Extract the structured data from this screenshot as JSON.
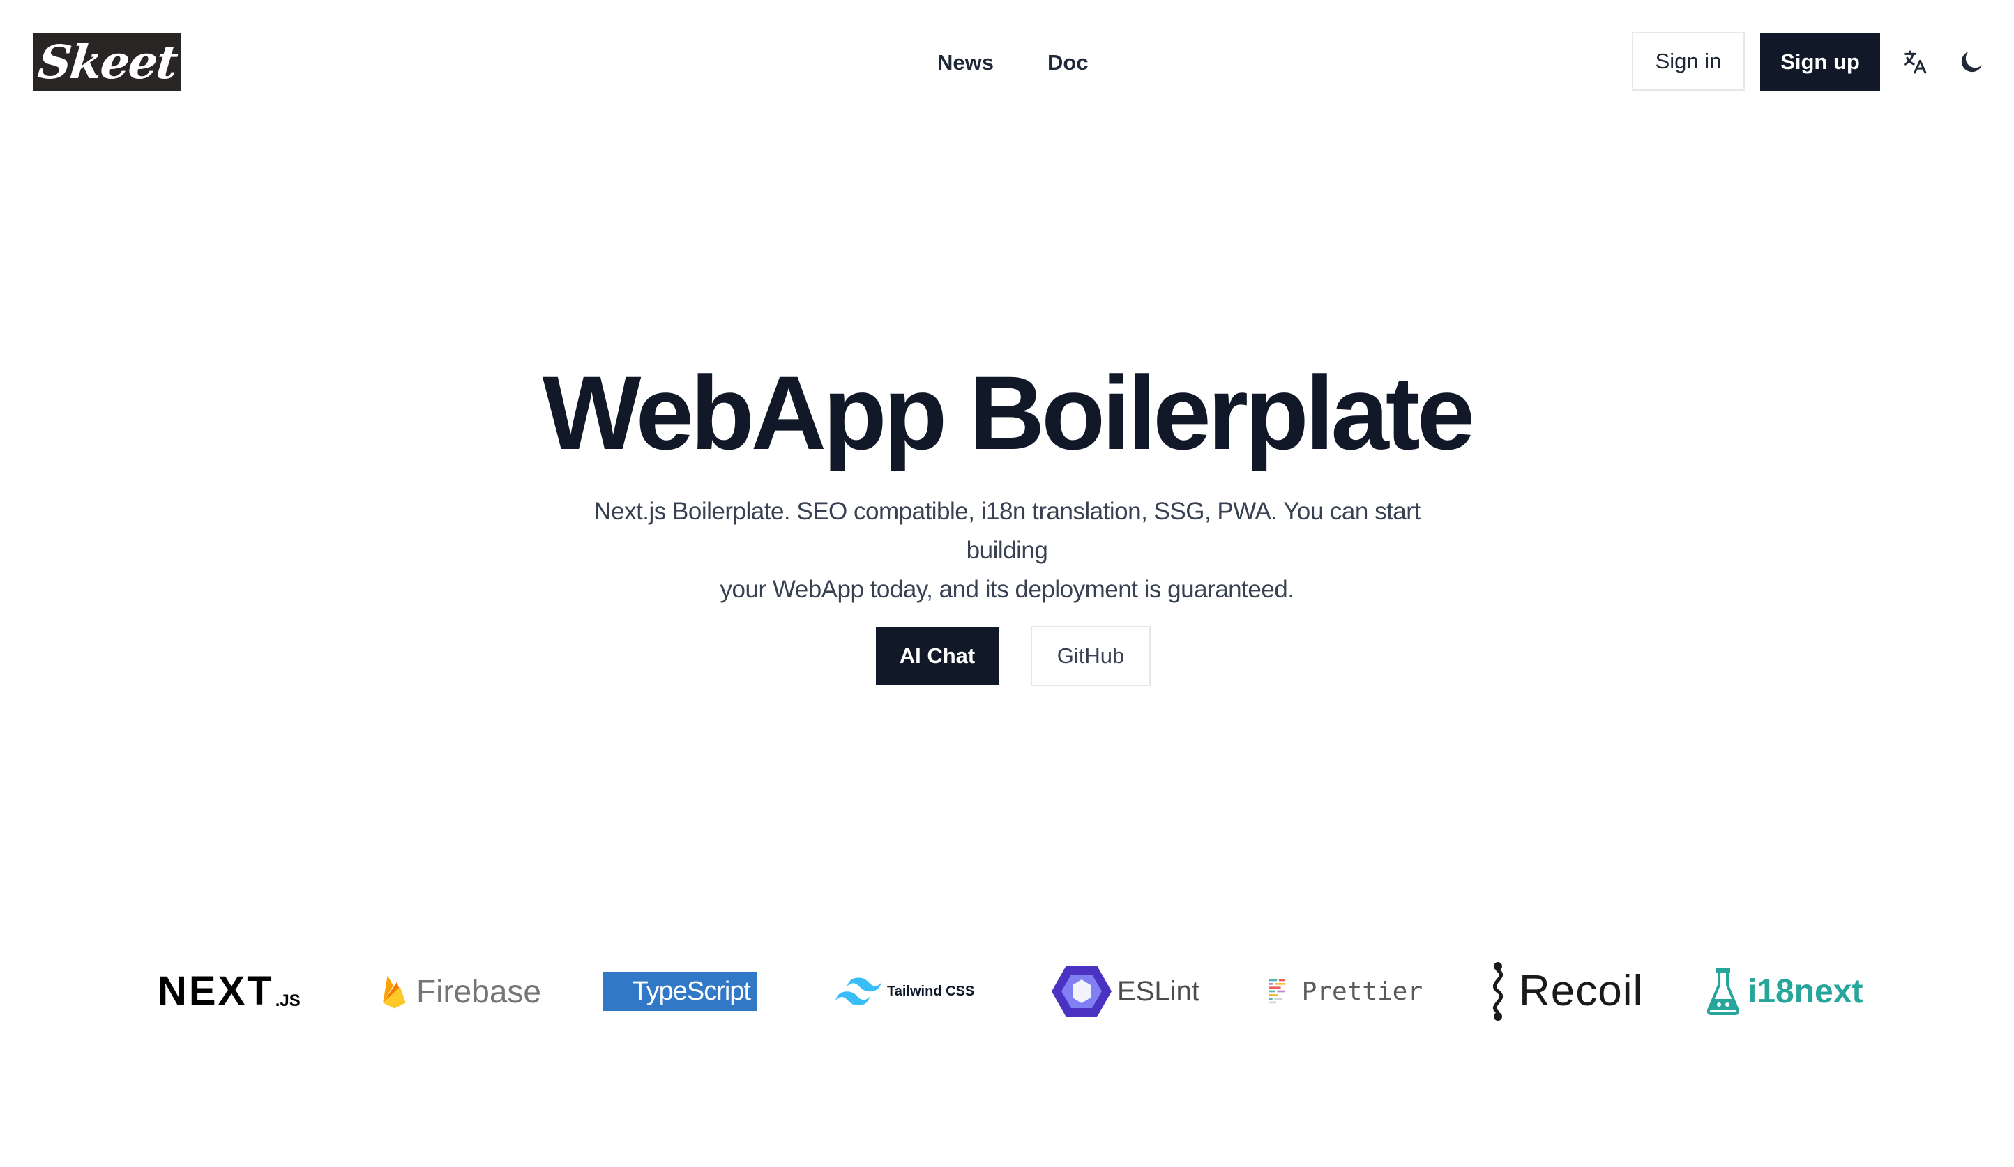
{
  "header": {
    "logo_text": "Skeet",
    "nav": [
      {
        "label": "News"
      },
      {
        "label": "Doc"
      }
    ],
    "sign_in_label": "Sign in",
    "sign_up_label": "Sign up",
    "icons": [
      "translate-icon",
      "moon-icon"
    ]
  },
  "hero": {
    "title": "WebApp Boilerplate",
    "description_line1": "Next.js Boilerplate. SEO compatible, i18n translation, SSG, PWA. You can start building",
    "description_line2": "your WebApp today, and its deployment is guaranteed.",
    "primary_button": "AI Chat",
    "secondary_button": "GitHub"
  },
  "tech_logos": {
    "nextjs": {
      "main": "NEXT",
      "suffix": ".JS"
    },
    "firebase": "Firebase",
    "typescript": "TypeScript",
    "tailwind": "Tailwind CSS",
    "eslint": "ESLint",
    "prettier": "Prettier",
    "recoil": "Recoil",
    "i18next": "i18next"
  },
  "colors": {
    "primary": "#111827",
    "border": "#e5e7eb",
    "firebase_yellow": "#FFCA28",
    "typescript_blue": "#3178C6",
    "tailwind_teal": "#38BDF8",
    "eslint_purple": "#4B32C3",
    "i18next_green": "#26A69A"
  }
}
